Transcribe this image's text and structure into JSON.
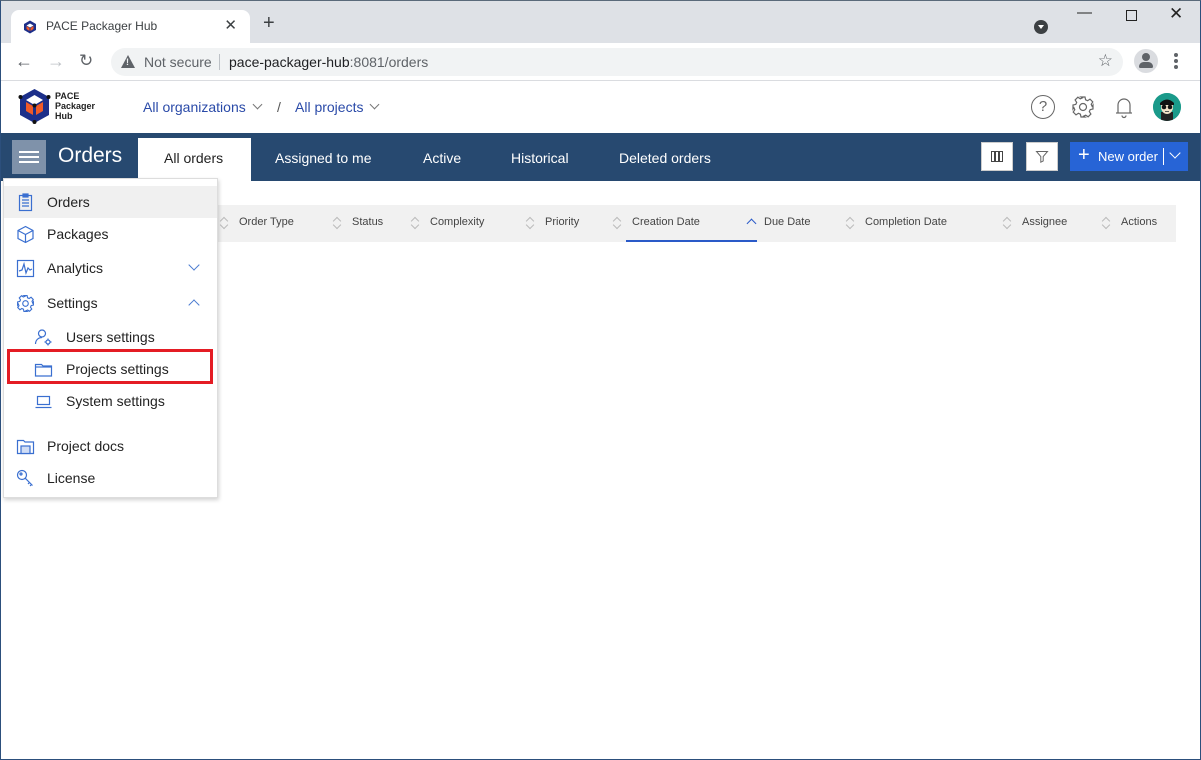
{
  "browser": {
    "tab_title": "PACE Packager Hub",
    "not_secure_label": "Not secure",
    "url_host": "pace-packager-hub",
    "url_path": ":8081/orders"
  },
  "header": {
    "logo_lines": [
      "PACE",
      "Packager",
      "Hub"
    ],
    "breadcrumb": {
      "organization": "All organizations",
      "separator": "/",
      "project": "All projects"
    },
    "help_glyph": "?"
  },
  "navbar": {
    "page_title": "Orders",
    "tabs": [
      {
        "label": "All orders",
        "active": true
      },
      {
        "label": "Assigned to me",
        "active": false
      },
      {
        "label": "Active",
        "active": false
      },
      {
        "label": "Historical",
        "active": false
      },
      {
        "label": "Deleted orders",
        "active": false
      }
    ],
    "new_order_label": "New order"
  },
  "table": {
    "columns": [
      {
        "label": "Order Type",
        "sort": "none"
      },
      {
        "label": "Status",
        "sort": "none"
      },
      {
        "label": "Complexity",
        "sort": "none"
      },
      {
        "label": "Priority",
        "sort": "none"
      },
      {
        "label": "Creation Date",
        "sort": "none"
      },
      {
        "label": "Due Date",
        "sort": "ascending"
      },
      {
        "label": "Completion Date",
        "sort": "none"
      },
      {
        "label": "Assignee",
        "sort": "none"
      },
      {
        "label": "Actions",
        "sort": "none"
      }
    ],
    "rows": []
  },
  "menu": {
    "items": [
      {
        "label": "Orders",
        "icon": "clipboard-icon",
        "hover": true
      },
      {
        "label": "Packages",
        "icon": "cube-icon"
      },
      {
        "label": "Analytics",
        "icon": "chart-icon",
        "expandable": "collapsed"
      },
      {
        "label": "Settings",
        "icon": "gear-icon",
        "expandable": "expanded"
      },
      {
        "label": "Users settings",
        "icon": "user-gear-icon",
        "sub": true
      },
      {
        "label": "Projects settings",
        "icon": "folder-icon",
        "sub": true,
        "highlighted": true
      },
      {
        "label": "System settings",
        "icon": "laptop-icon",
        "sub": true
      },
      {
        "label": "Project docs",
        "icon": "docs-folder-icon"
      },
      {
        "label": "License",
        "icon": "key-icon"
      }
    ]
  },
  "colors": {
    "navbar": "#274970",
    "accent": "#2764d6",
    "highlight_box": "#e41c24",
    "menu_icon": "#3a6fd0"
  }
}
